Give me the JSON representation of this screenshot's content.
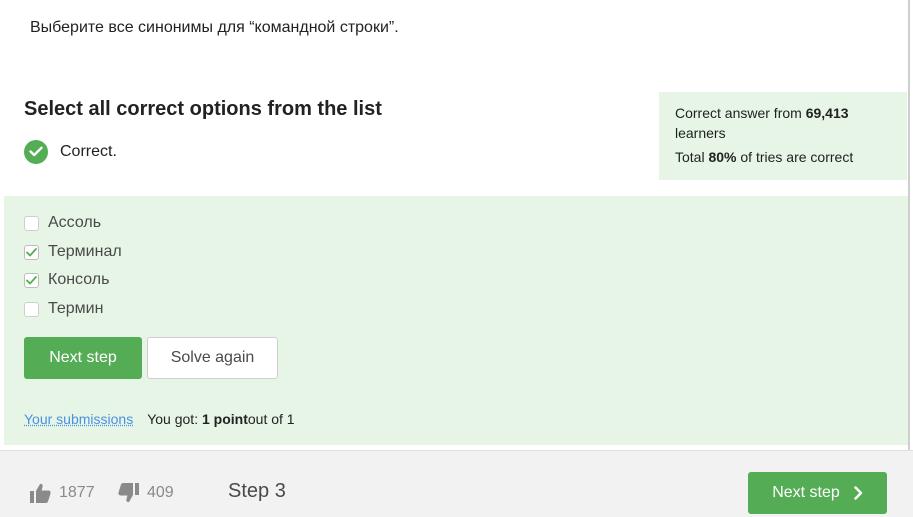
{
  "question": {
    "text": "Выберите все синонимы для “командной строки”."
  },
  "heading": "Select all correct options from the list",
  "status": {
    "text": "Correct.",
    "icon": "check-icon"
  },
  "stats": {
    "line1_prefix": "Correct answer from ",
    "line1_count": "69,413",
    "line1_suffix": "learners",
    "line2_prefix": "Total ",
    "line2_percent": "80%",
    "line2_suffix": " of tries are correct"
  },
  "options": [
    {
      "label": "Ассоль",
      "checked": false
    },
    {
      "label": "Терминал",
      "checked": true
    },
    {
      "label": "Консоль",
      "checked": true
    },
    {
      "label": "Термин",
      "checked": false
    }
  ],
  "buttons": {
    "next": "Next step",
    "solve_again": "Solve again"
  },
  "submissions": {
    "link": "Your submissions",
    "result_prefix": "You got: ",
    "result_points": "1 point",
    "result_suffix": " out of 1"
  },
  "footer": {
    "likes": "1877",
    "dislikes": "409",
    "step": "Step 3",
    "next": "Next step"
  },
  "colors": {
    "accent": "#54ad54",
    "panel": "#e6f5e6",
    "link": "#4a90e2"
  }
}
